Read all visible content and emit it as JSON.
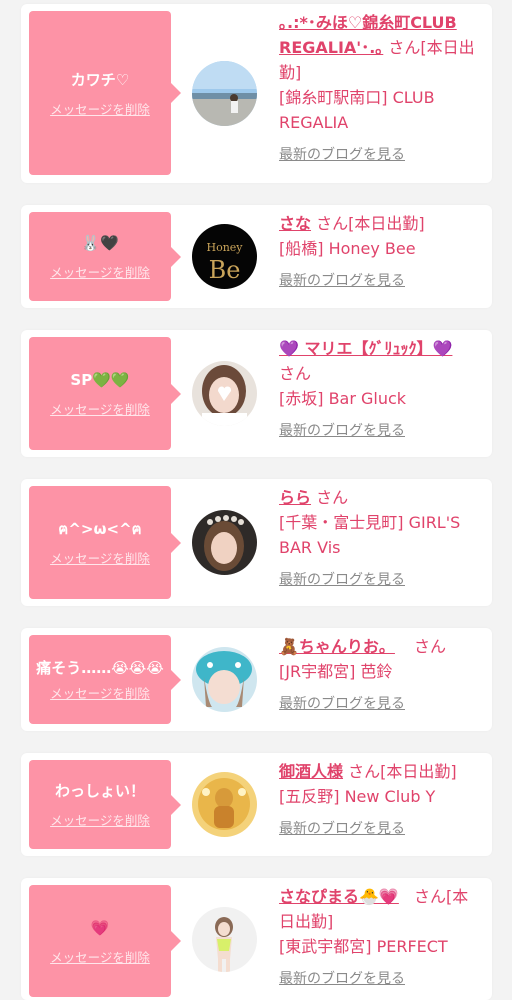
{
  "colors": {
    "accent": "#e0436b",
    "bubble": "#fd93a6",
    "card": "#ffffff",
    "background": "#f3f3f3"
  },
  "items": [
    {
      "memo": "カワチ♡",
      "delete_label": "メッセージを削除",
      "name": "｡.:*･みほ♡錦糸町CLUB REGALIA'･.｡",
      "san_label": "さん[本日出勤]",
      "shop_label": "[錦糸町駅南口] CLUB REGALIA",
      "blog_label": "最新のブログを見る"
    },
    {
      "memo": "🐰🖤",
      "delete_label": "メッセージを削除",
      "name": "さな",
      "san_label": "さん[本日出勤]",
      "shop_label": "[船橋] Honey Bee",
      "blog_label": "最新のブログを見る",
      "avatar_text": "Honey",
      "avatar_text2": "Be"
    },
    {
      "memo": "SP💚💚",
      "delete_label": "メッセージを削除",
      "name": "💜 マリエ【ｸﾞﾘｭｯｸ】💜",
      "san_label": "さん",
      "shop_label": "[赤坂] Bar Gluck",
      "blog_label": "最新のブログを見る"
    },
    {
      "memo": "ฅ^>ω<^ฅ",
      "delete_label": "メッセージを削除",
      "name": "らら",
      "san_label": "さん",
      "shop_label": "[千葉・富士見町] GIRL'S BAR Vis",
      "blog_label": "最新のブログを見る"
    },
    {
      "memo": "痛そう……😭😭😭",
      "delete_label": "メッセージを削除",
      "name": "🧸ちゃんりお。",
      "san_label": "さん",
      "shop_label": "[JR宇都宮] 芭鈴",
      "blog_label": "最新のブログを見る"
    },
    {
      "memo": "わっしょい！",
      "delete_label": "メッセージを削除",
      "name": "御酒人様",
      "san_label": "さん[本日出勤]",
      "shop_label": "[五反野] New Club Y",
      "blog_label": "最新のブログを見る"
    },
    {
      "memo": "💗",
      "delete_label": "メッセージを削除",
      "name": "さなぴまる🐣💗",
      "san_label": "さん[本日出勤]",
      "shop_label": "[東武宇都宮] PERFECT",
      "blog_label": "最新のブログを見る"
    }
  ]
}
